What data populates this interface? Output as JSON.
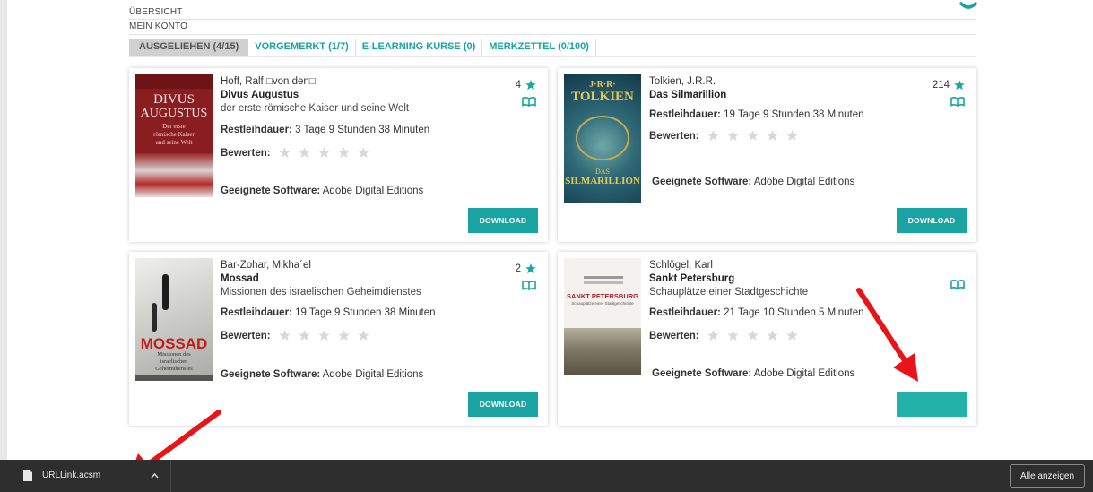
{
  "nav": {
    "links": [
      "ÜBERSICHT",
      "MEIN KONTO"
    ]
  },
  "tabs": [
    {
      "label": "AUSGELIEHEN (4/15)",
      "active": true
    },
    {
      "label": "VORGEMERKT (1/7)",
      "active": false
    },
    {
      "label": "E-LEARNING KURSE (0)",
      "active": false
    },
    {
      "label": "MERKZETTEL (0/100)",
      "active": false
    }
  ],
  "labels": {
    "remaining": "Restleihdauer:",
    "rate": "Bewerten:",
    "software": "Geeignete Software:",
    "download": "DOWNLOAD"
  },
  "books": [
    {
      "author": "Hoff, Ralf □von den□",
      "title": "Divus Augustus",
      "subtitle": "der erste römische Kaiser und seine Welt",
      "remaining": "3 Tage 9 Stunden 38 Minuten",
      "software": "Adobe Digital Editions",
      "rating_count": "4",
      "cover": {
        "line1": "DIVUS",
        "line2": "AUGUSTUS",
        "line3": "Der erste",
        "line4": "römische Kaiser",
        "line5": "und seine Welt",
        "bg": "#8a1d1f"
      }
    },
    {
      "author": "Tolkien, J.R.R.",
      "title": "Das Silmarillion",
      "subtitle": "",
      "remaining": "19 Tage 9 Stunden 38 Minuten",
      "software": "Adobe Digital Editions",
      "rating_count": "214",
      "cover": {
        "line1": "J·R·R·",
        "line2": "TOLKIEN",
        "line3": "DAS",
        "line4": "SILMARILLION",
        "bg": "#1f5a6b"
      }
    },
    {
      "author": "Bar-Zohar, Mikha´el",
      "title": "Mossad",
      "subtitle": "Missionen des israelischen Geheimdienstes",
      "remaining": "19 Tage 9 Stunden 38 Minuten",
      "software": "Adobe Digital Editions",
      "rating_count": "2",
      "cover": {
        "line1": "MOSSAD",
        "line2": "Missionen des",
        "line3": "israelischen",
        "line4": "Geheimdienstes",
        "bg": "#d9d9d6"
      }
    },
    {
      "author": "Schlögel, Karl",
      "title": "Sankt Petersburg",
      "subtitle": "Schauplätze einer Stadtgeschichte",
      "remaining": "21 Tage 10 Stunden 5 Minuten",
      "software": "Adobe Digital Editions",
      "rating_count": "",
      "cover": {
        "line1": "SANKT PETERSBURG",
        "line2": "Schauplätze einer Stadtgeschichte",
        "bg": "#f4f2ee"
      }
    }
  ],
  "download_bar": {
    "file_name": "URLLink.acsm",
    "show_all": "Alle anzeigen"
  },
  "colors": {
    "accent": "#1aa3a3",
    "arrow": "#e8141a",
    "bar": "#2e2e2e"
  }
}
